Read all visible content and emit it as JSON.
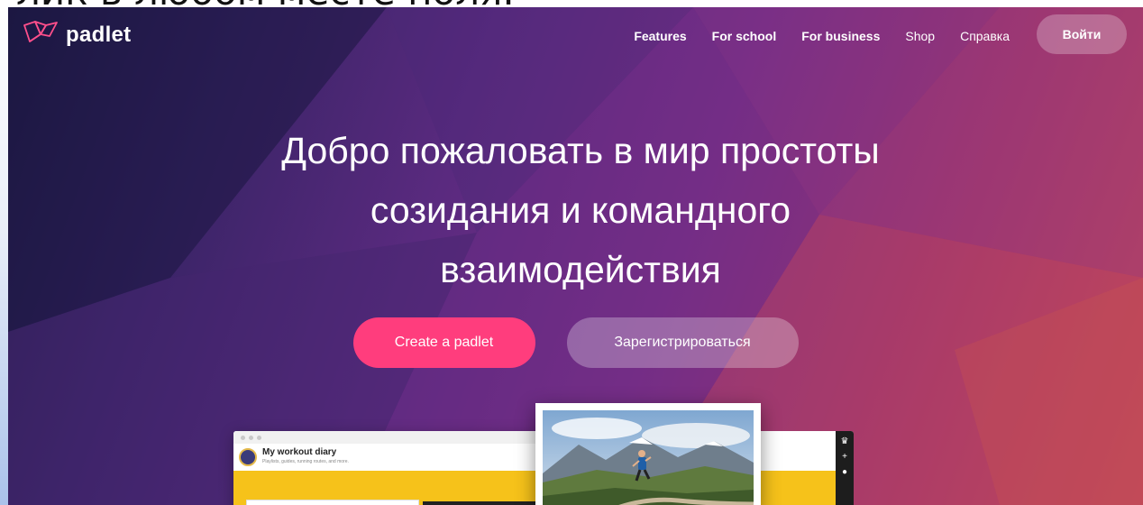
{
  "slide": {
    "heading_fragment": "лик в любом месте поля."
  },
  "brand": {
    "name": "padlet",
    "accent": "#ff3d7d"
  },
  "nav": {
    "links": [
      "Features",
      "For school",
      "For business",
      "Shop",
      "Справка"
    ],
    "login_label": "Войти"
  },
  "hero": {
    "headline_lines": [
      "Добро пожаловать в мир простоты",
      "созидания и командного",
      "взаимодействия"
    ],
    "primary_cta": "Create a padlet",
    "secondary_cta": "Зарегистрироваться"
  },
  "preview": {
    "board_title": "My workout diary",
    "board_subtitle": "Playlists, guides, running routes, and more."
  },
  "icons": [
    "padlet-logo-icon",
    "crown-icon",
    "plus-icon",
    "user-icon"
  ]
}
